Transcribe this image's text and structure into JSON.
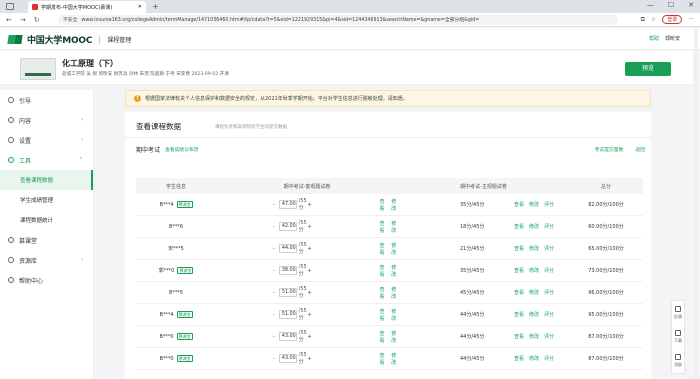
{
  "browser": {
    "tab_title": "学期发布-中国大学MOOC(慕课)",
    "new_tab": "+",
    "window_controls": [
      "—",
      "☐",
      "✕"
    ],
    "nav": [
      "←",
      "→",
      "↻"
    ],
    "not_secure": "不安全",
    "url": "www.icourse163.org/collegeAdmin/termManage/1471036460.htm#/tp/cdata?t=5&eid=1221929315&pi=4&sid=1244346913&searchName=&gname=全部分组&gid=",
    "login_label": "登录",
    "more": "···"
  },
  "site_header": {
    "logo_text": "中国大学MOOC",
    "section": "课程管理",
    "links": [
      "帮助",
      "郭昕安"
    ]
  },
  "course": {
    "title": "化工原理（下）",
    "meta": "盐城工学院  吴 锐 郭昕安 顾苏兵 孙林 朱茂 陈超颖 于冉 宋李费     2023-09-02 开课",
    "publish_label": "预览"
  },
  "sidebar": {
    "items": [
      {
        "label": "引导",
        "icon": "compass-icon"
      },
      {
        "label": "内容",
        "icon": "document-icon",
        "caret": "›"
      },
      {
        "label": "设置",
        "icon": "gear-icon",
        "caret": "›"
      },
      {
        "label": "工具",
        "icon": "tool-icon",
        "caret": "⌃"
      }
    ],
    "sub_items": [
      "查看课程数据",
      "学生成绩管理",
      "课程数据统计"
    ],
    "items_after": [
      {
        "label": "慕课堂",
        "icon": "classroom-icon"
      },
      {
        "label": "资源库",
        "icon": "library-icon",
        "caret": "›"
      },
      {
        "label": "帮助中心",
        "icon": "help-icon"
      }
    ]
  },
  "notice": {
    "icon": "!",
    "text": "根据国家法律有关个人信息保护和数据安全的规定，从2021年秋季学期开始，平台对学生信息进行脱敏处理，请知悉。"
  },
  "card": {
    "title": "查看课程数据",
    "subtitle": "课程负责和高等院校学生的提交数据",
    "exam_title": "期中考试",
    "exam_link": "查看成绩公布页",
    "right_links": [
      "考试提交量数",
      "返回"
    ]
  },
  "table": {
    "headers": [
      "学生信息",
      "期中考试-客观题试卷",
      "期中考试-主观题试卷",
      "总分"
    ],
    "actions_objective": [
      "查看",
      "修改"
    ],
    "actions_subjective": [
      "查看",
      "修改",
      "评分"
    ],
    "badge": "慕课堂",
    "rows": [
      {
        "student": "B***4",
        "badge": true,
        "obj_score": "47.00",
        "obj_total": "/55分",
        "subj": "35分/45分",
        "total": "82.00分/100分"
      },
      {
        "student": "B***6",
        "badge": false,
        "obj_score": "42.00",
        "obj_total": "/55分",
        "subj": "18分/45分",
        "total": "60.00分/100分"
      },
      {
        "student": "宋***5",
        "badge": false,
        "obj_score": "44.00",
        "obj_total": "/55分",
        "subj": "21分/45分",
        "total": "65.00分/100分"
      },
      {
        "student": "郭***0",
        "badge": true,
        "obj_score": "38.00",
        "obj_total": "/55分",
        "subj": "35分/45分",
        "total": "73.00分/100分"
      },
      {
        "student": "B***5",
        "badge": false,
        "obj_score": "51.00",
        "obj_total": "/55分",
        "subj": "45分/45分",
        "total": "96.00分/100分"
      },
      {
        "student": "B***4",
        "badge": true,
        "obj_score": "51.00",
        "obj_total": "/55分",
        "subj": "44分/45分",
        "total": "95.00分/100分"
      },
      {
        "student": "B***0",
        "badge": true,
        "obj_score": "43.00",
        "obj_total": "/55分",
        "subj": "44分/45分",
        "total": "87.00分/100分"
      },
      {
        "student": "B***0",
        "badge": true,
        "obj_score": "43.00",
        "obj_total": "/55分",
        "subj": "44分/45分",
        "total": "87.00分/100分"
      }
    ]
  },
  "float_tools": [
    "反馈",
    "下载",
    "顶部"
  ],
  "colors": {
    "accent": "#18a058",
    "notice_bg": "#fdf6e4",
    "badge": "#18a058"
  }
}
